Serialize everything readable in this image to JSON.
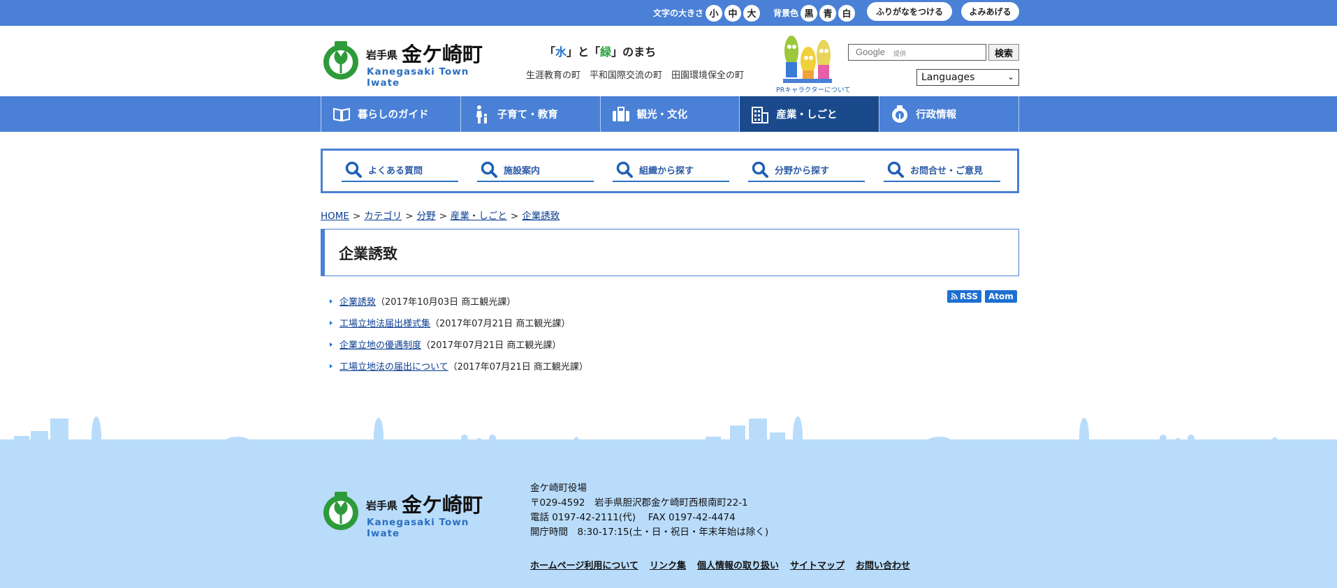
{
  "topbar": {
    "font_size_label": "文字の大きさ",
    "font_sizes": [
      "小",
      "中",
      "大"
    ],
    "bg_label": "背景色",
    "bg_colors": [
      "黒",
      "青",
      "白"
    ],
    "furigana_button": "ふりがなをつける",
    "readaloud_button": "よみあげる"
  },
  "header": {
    "logo_pref": "岩手県",
    "logo_town": "金ケ崎町",
    "logo_roman": "Kanegasaki Town Iwate",
    "tagline_open1": "「",
    "tagline_water": "水",
    "tagline_close1": "」と「",
    "tagline_green": "緑",
    "tagline_close2": "」のまち",
    "subtagline": "生涯教育の町　平和国際交流の町　田園環境保全の町",
    "mascot_label": "PRキャラクターについて",
    "search_google": "Google",
    "search_provided": "提供",
    "search_button": "検索",
    "language_select": "Languages"
  },
  "gnav": [
    {
      "label": "暮らしのガイド",
      "icon": "book-icon"
    },
    {
      "label": "子育て・教育",
      "icon": "parent-child-icon"
    },
    {
      "label": "観光・文化",
      "icon": "suitcase-icon"
    },
    {
      "label": "産業・しごと",
      "icon": "building-icon",
      "active": true
    },
    {
      "label": "行政情報",
      "icon": "town-emblem-icon"
    }
  ],
  "subnav": [
    "よくある質問",
    "施設案内",
    "組織から探す",
    "分野から探す",
    "お問合せ・ご意見"
  ],
  "breadcrumb": [
    "HOME",
    "カテゴリ",
    "分野",
    "産業・しごと",
    "企業誘致"
  ],
  "page_title": "企業誘致",
  "feeds": [
    "RSS",
    "Atom"
  ],
  "articles": [
    {
      "title": "企業誘致",
      "meta": "（2017年10月03日  商工観光課）"
    },
    {
      "title": "工場立地法届出様式集",
      "meta": "（2017年07月21日  商工観光課）"
    },
    {
      "title": "企業立地の優遇制度",
      "meta": "（2017年07月21日  商工観光課）"
    },
    {
      "title": "工場立地法の届出について",
      "meta": "（2017年07月21日  商工観光課）"
    }
  ],
  "footer": {
    "office": "金ケ崎町役場",
    "address": "〒029-4592　岩手県胆沢郡金ケ崎町西根南町22-1",
    "phone": "電話 0197-42-2111(代)　 FAX 0197-42-4474",
    "hours": "開庁時間　8:30-17:15(土・日・祝日・年末年始は除く)",
    "links": [
      "ホームページ利用について",
      "リンク集",
      "個人情報の取り扱い",
      "サイトマップ",
      "お問い合わせ"
    ]
  },
  "colors": {
    "brand_blue": "#4a80d6",
    "nav_active": "#1b4a8c",
    "footer_bg": "#b9dcfb",
    "logo_green": "#2e9b3a"
  }
}
